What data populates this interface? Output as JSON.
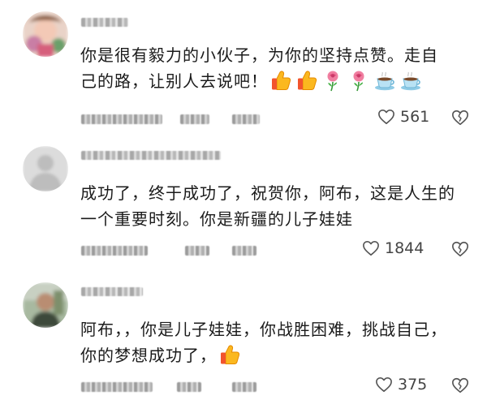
{
  "comments": [
    {
      "text_line1": "你是很有毅力的小伙子，为你的坚持点赞。走自",
      "text_line2": "己的路，让别人去说吧！",
      "emojis": [
        "thumbs-up-icon",
        "thumbs-up-icon",
        "rose-icon",
        "rose-icon",
        "coffee-icon",
        "coffee-icon"
      ],
      "likes": "561"
    },
    {
      "text_line1": "成功了，终于成功了，祝贺你，阿布，这是人生的",
      "text_line2": "一个重要时刻。你是新疆的儿子娃娃",
      "emojis": [],
      "likes": "1844"
    },
    {
      "text_line1": "阿布，，你是儿子娃娃，你战胜困难，挑战自己，",
      "text_line2": "你的梦想成功了，",
      "emojis": [
        "thumbs-up-icon"
      ],
      "likes": "375"
    }
  ],
  "colors": {
    "text": "#1b1b1b",
    "meta": "#444444",
    "thumb": "#f5a623",
    "rose": "#e8628a",
    "cup": "#a7d8ef"
  }
}
